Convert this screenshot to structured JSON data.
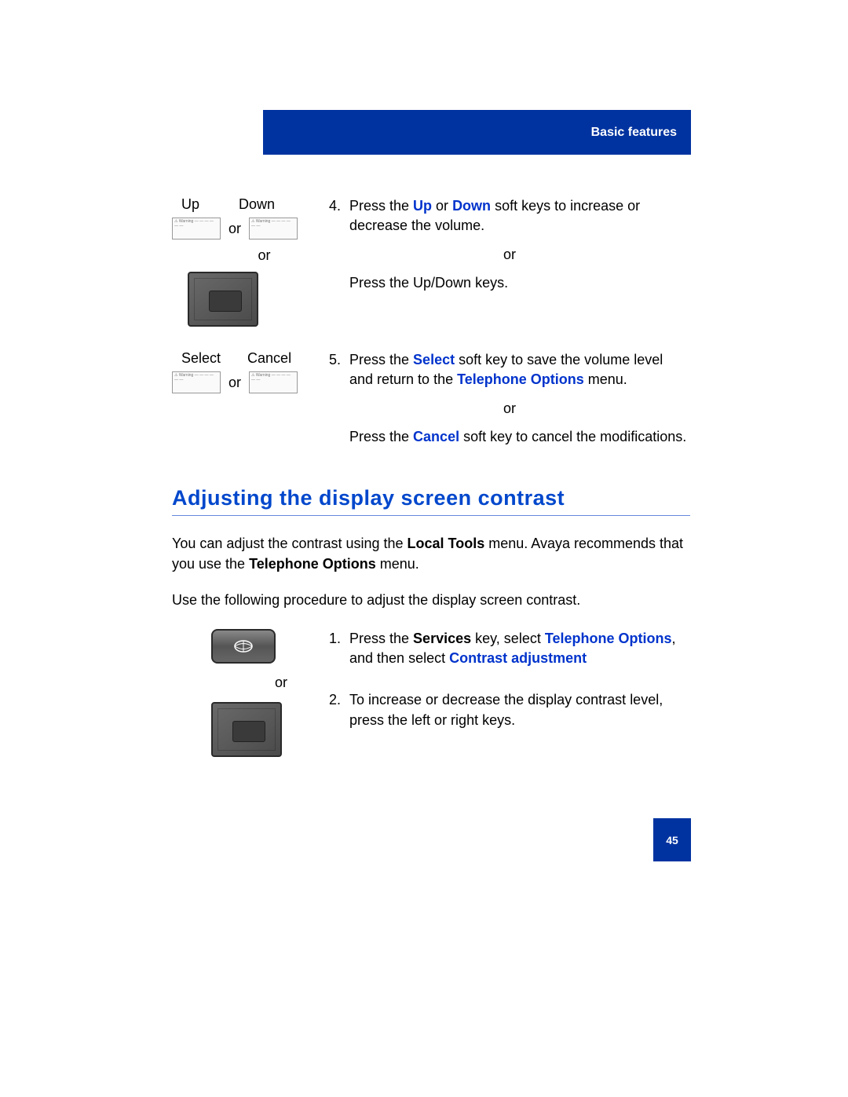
{
  "header": {
    "section_title": "Basic features"
  },
  "labels": {
    "up": "Up",
    "down": "Down",
    "select": "Select",
    "cancel": "Cancel",
    "or": "or"
  },
  "step4": {
    "num": "4.",
    "text_before": "Press the ",
    "term_up": "Up",
    "text_mid": " or ",
    "term_down": "Down",
    "text_after": " soft keys to increase or decrease the volume.",
    "or": "or",
    "alt": "Press the Up/Down keys."
  },
  "step5": {
    "num": "5.",
    "text_before": "Press the ",
    "term_select": "Select",
    "text_mid": " soft key to save the volume level and return to the ",
    "term_menu": "Telephone Options",
    "text_after": " menu.",
    "or": "or",
    "alt_before": "Press the ",
    "term_cancel": "Cancel",
    "alt_after": " soft key to cancel the modifications."
  },
  "heading": "Adjusting the display screen contrast",
  "para1": {
    "t1": "You can adjust the contrast using the ",
    "b1": "Local Tools",
    "t2": " menu. Avaya recommends that you use the ",
    "b2": "Telephone Options",
    "t3": " menu."
  },
  "para2": "Use the following procedure to adjust the display screen contrast.",
  "step1": {
    "num": "1.",
    "t1": "Press the ",
    "b1": "Services",
    "t2": " key, select ",
    "blue1": "Telephone Options",
    "t3": ", and then select ",
    "blue2": "Contrast adjustment"
  },
  "step2": {
    "num": "2.",
    "text": "To increase or decrease the display contrast level, press the left or right keys."
  },
  "page_number": "45"
}
